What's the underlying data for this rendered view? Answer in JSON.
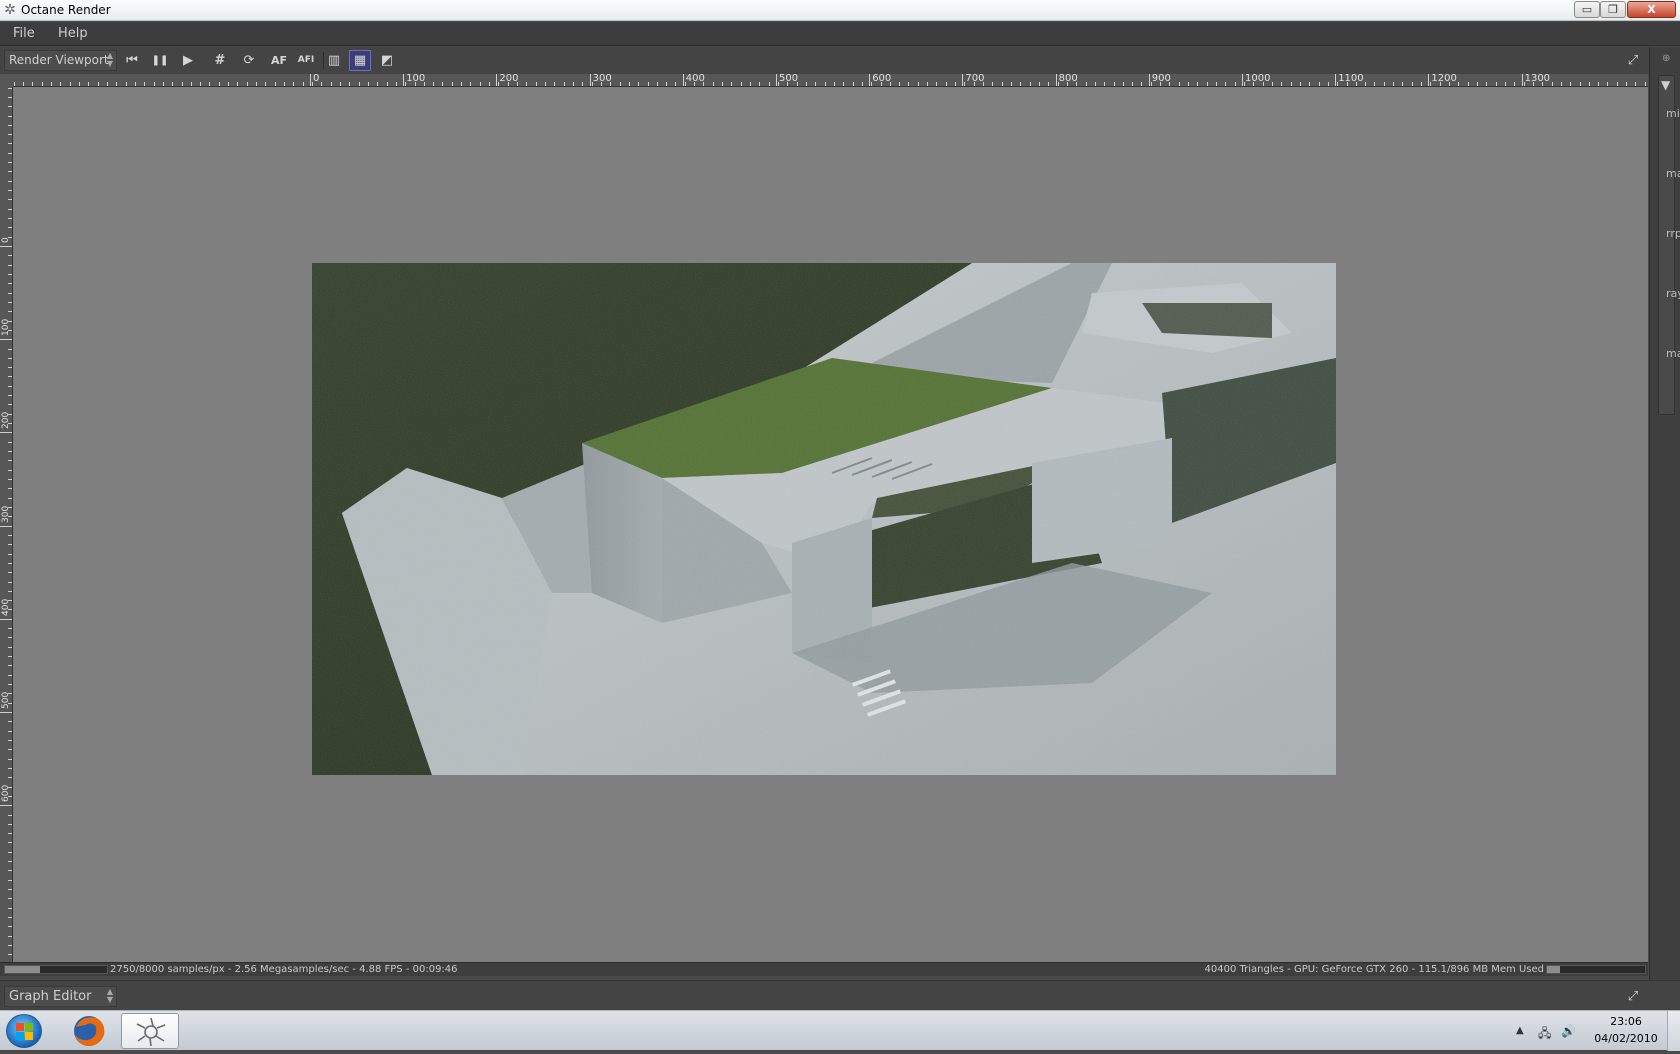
{
  "window": {
    "title": "Octane Render",
    "controls": {
      "minimize": "▭",
      "maximize": "❐",
      "close": "X"
    }
  },
  "menu": {
    "items": [
      "File",
      "Help"
    ]
  },
  "toolbar": {
    "viewport_select": "Render Viewport",
    "buttons": [
      {
        "name": "restart-icon",
        "glyph": "⏮"
      },
      {
        "name": "pause-icon",
        "glyph": "❚❚"
      },
      {
        "name": "play-icon",
        "glyph": "▶"
      },
      {
        "name": "grid-icon",
        "glyph": "#"
      },
      {
        "name": "refresh-icon",
        "glyph": "⟳"
      },
      {
        "name": "autofocus-icon",
        "glyph": "AF"
      },
      {
        "name": "autofocus-select-icon",
        "glyph": "AFI"
      },
      {
        "name": "display-mode-icon",
        "glyph": "▥"
      },
      {
        "name": "checker-icon",
        "glyph": "▦"
      },
      {
        "name": "region-icon",
        "glyph": "◩"
      }
    ],
    "fullscreen_glyph": "⤢"
  },
  "ruler": {
    "top_labels": [
      "0",
      "100",
      "200",
      "300",
      "400",
      "500",
      "600",
      "700",
      "800",
      "900",
      "1000",
      "1100",
      "1200",
      "1300"
    ],
    "left_labels": [
      "0",
      "100",
      "200",
      "300",
      "400",
      "500",
      "600"
    ]
  },
  "side_panel": {
    "labels": [
      "mi",
      "ma",
      "rrp",
      "ray",
      "ma"
    ]
  },
  "status": {
    "left": "2750/8000 samples/px - 2.56 Megasamples/sec - 4.88 FPS - 00:09:46",
    "right": "40400 Triangles - GPU: GeForce GTX 260 - 115.1/896 MB Mem Used",
    "samples_progress": 0.34,
    "memory_progress": 0.13
  },
  "graph_editor": {
    "select": "Graph Editor"
  },
  "taskbar": {
    "time": "23:06",
    "date": "04/02/2010"
  },
  "colors": {
    "accent_selected": "#3b3f75",
    "viewport_bg": "#7f7f7f",
    "grass": "#4e6e2c",
    "building": "#b9c2c7"
  }
}
